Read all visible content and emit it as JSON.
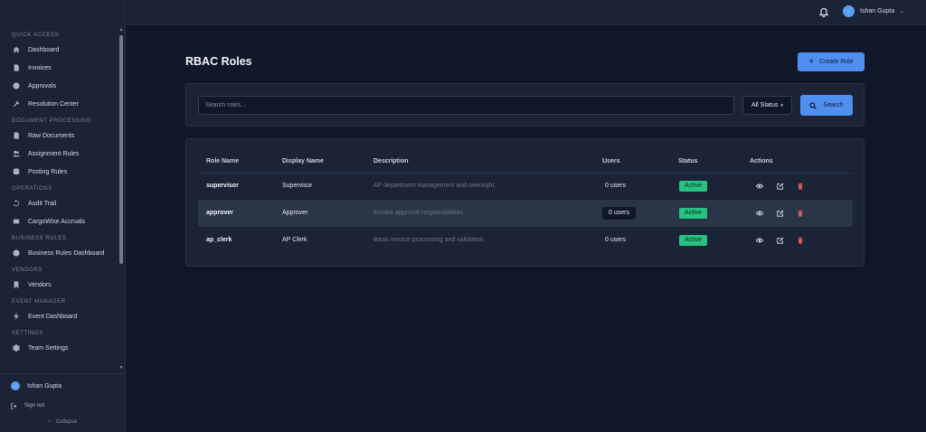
{
  "sidebar": {
    "sections": [
      {
        "title": "QUICK ACCESS",
        "items": [
          {
            "label": "Dashboard",
            "icon": "home-icon"
          },
          {
            "label": "Invoices",
            "icon": "document-icon"
          },
          {
            "label": "Approvals",
            "icon": "check-circle-icon"
          },
          {
            "label": "Resolution Center",
            "icon": "wrench-icon"
          }
        ]
      },
      {
        "title": "DOCUMENT PROCESSING",
        "items": [
          {
            "label": "Raw Documents",
            "icon": "file-icon"
          },
          {
            "label": "Assignment Rules",
            "icon": "users-icon"
          },
          {
            "label": "Posting Rules",
            "icon": "database-icon"
          }
        ]
      },
      {
        "title": "OPERATIONS",
        "items": [
          {
            "label": "Audit Trail",
            "icon": "history-icon"
          },
          {
            "label": "CargoWise Accruals",
            "icon": "ship-icon"
          }
        ]
      },
      {
        "title": "BUSINESS RULES",
        "items": [
          {
            "label": "Business Rules Dashboard",
            "icon": "gauge-icon"
          }
        ]
      },
      {
        "title": "VENDORS",
        "items": [
          {
            "label": "Vendors",
            "icon": "building-icon"
          }
        ]
      },
      {
        "title": "EVENT MANAGER",
        "items": [
          {
            "label": "Event Dashboard",
            "icon": "bolt-icon"
          }
        ]
      },
      {
        "title": "SETTINGS",
        "items": [
          {
            "label": "Team Settings",
            "icon": "gear-icon"
          }
        ]
      }
    ],
    "user": {
      "name": "Ishan Gupta",
      "avatar_text": "..."
    },
    "sign_out": "Sign out",
    "collapse": "Collapse"
  },
  "topbar": {
    "user_name": "Ishan Gupta",
    "avatar_text": "..."
  },
  "main": {
    "title": "RBAC Roles",
    "create_button": "Create Role",
    "search": {
      "placeholder": "Search roles...",
      "value": ""
    },
    "status_filter": "All Status",
    "search_button": "Search",
    "table": {
      "headers": [
        "Role Name",
        "Display Name",
        "Description",
        "Users",
        "Status",
        "Actions"
      ],
      "rows": [
        {
          "name": "supervisor",
          "display": "Supervisor",
          "description": "AP department management and oversight",
          "users": "0 users",
          "status": "Active"
        },
        {
          "name": "approver",
          "display": "Approver",
          "description": "Invoice approval responsibilities",
          "users": "0 users",
          "status": "Active"
        },
        {
          "name": "ap_clerk",
          "display": "AP Clerk",
          "description": "Basic invoice processing and validation",
          "users": "0 users",
          "status": "Active"
        }
      ]
    }
  },
  "colors": {
    "background": "#0f1729",
    "panel": "#1b2436",
    "accent": "#4f8ff0",
    "active_badge": "#27c281",
    "delete": "#e05a5a"
  }
}
